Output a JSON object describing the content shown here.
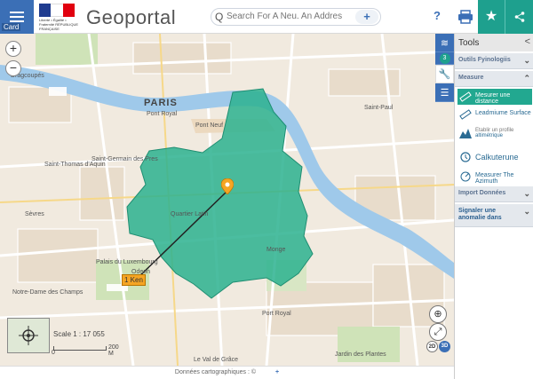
{
  "header": {
    "card_label": "Card",
    "logo_text": "Liberté • Égalité • Fraternité RÉPUBLIQUE FRANÇAISE",
    "brand": "Geoportal",
    "search_icon": "Q",
    "search_placeholder": "Search For A Neu. An Address, A Data",
    "search_add": "+",
    "help_label": "?",
    "favorite_icon": "★",
    "share_icon": "<"
  },
  "map": {
    "city_label": "PARIS",
    "zoom_in": "+",
    "zoom_out": "−",
    "distance_label": "1 Ken",
    "scale_text": "Scale 1 : 17 055",
    "scale_zero": "0",
    "scale_value": "200 M",
    "mode_2d": "2D",
    "mode_3d": "3D",
    "street_labels": [
      "Dragcoupés",
      "Saint-Germain des Pres",
      "Pont Royal",
      "Pont Neuf",
      "Saint-Thomas d'Aquin",
      "Palais du Luxembourg",
      "Notre-Dame des Champs",
      "Port Royal",
      "Le Val de Grâce",
      "Saint-Paul",
      "Quartier Latin",
      "Jardin des Plantes",
      "Odeon",
      "Monge",
      "Sèvres"
    ]
  },
  "panel": {
    "title": "Tools",
    "close": "<",
    "sections": {
      "graphic": "Outils Fyinologiis",
      "measure": "Measure",
      "import": "Import Données"
    },
    "tools": {
      "measure_distance": "Mesurer une distance",
      "measure_surface": "Leadmiume Surface",
      "profile_title": "Etablir un profile",
      "profile_sub": "altimétrique",
      "calculate": "Calkuterune",
      "measure_azimuth": "Measurer The Azimuth",
      "report_anomaly": "Signaler une anomalie dans"
    }
  },
  "side_tools": {
    "layers_count": "3"
  },
  "footer": {
    "credits": "Données cartographiques : ©",
    "plus": "+"
  },
  "colors": {
    "primary_blue": "#3b6fb6",
    "teal": "#1ea08e",
    "isochrone": "#2bb28f",
    "marker_orange": "#f5a524"
  }
}
